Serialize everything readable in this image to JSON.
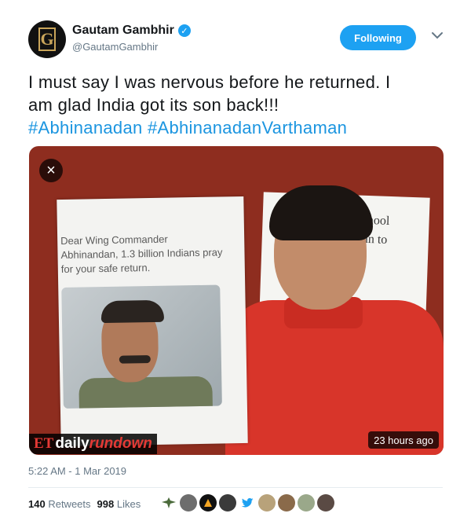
{
  "user": {
    "display_name": "Gautam Gambhir",
    "handle": "@GautamGambhir",
    "avatar_letter": "G",
    "verified": true
  },
  "follow_button": {
    "label": "Following"
  },
  "tweet": {
    "line1": "I must say I was nervous before he returned. I",
    "line2": "am glad India got its son back!!!",
    "hashtag1": "#Abhinanadan",
    "hashtag2": "#AbhinanadanVarthaman"
  },
  "media": {
    "close_label": "×",
    "sign_text": "Dear Wing Commander Abhinandan, 1.3 billion Indians pray for your safe return.",
    "sign_right_text1": "school",
    "sign_right_text2": "dan to",
    "brand_et": "ET",
    "brand_daily": "daily",
    "brand_rundown": "rundown",
    "time_badge": "23 hours ago"
  },
  "meta": {
    "timestamp": "5:22 AM - 1 Mar 2019",
    "retweets_count": "140",
    "retweets_label": "Retweets",
    "likes_count": "998",
    "likes_label": "Likes"
  },
  "colors": {
    "accent": "#1da1f2",
    "hashtag": "#1b95e0",
    "muted": "#657786"
  }
}
